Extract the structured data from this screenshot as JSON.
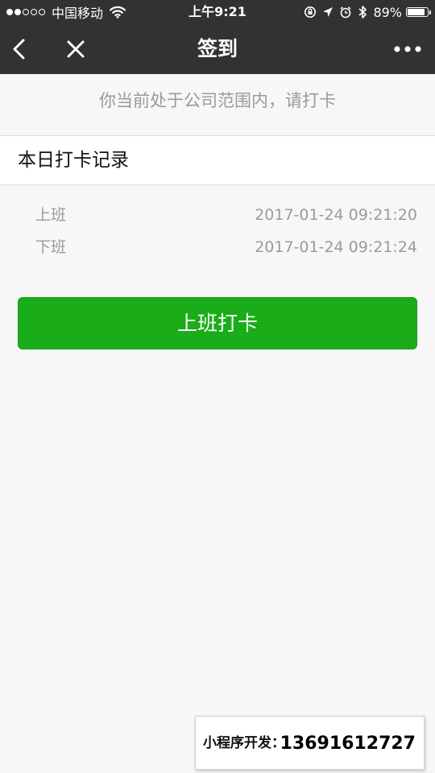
{
  "status_bar": {
    "carrier": "中国移动",
    "time": "上午9:21",
    "battery_percent": "89%",
    "battery_level": 0.89,
    "signal_filled": 2,
    "signal_total": 5
  },
  "nav": {
    "title": "签到",
    "back_icon": "chevron-left-icon",
    "close_icon": "close-icon",
    "more_icon": "more-dots-icon"
  },
  "notice": "你当前处于公司范围内，请打卡",
  "records_section": {
    "title": "本日打卡记录",
    "items": [
      {
        "label": "上班",
        "time": "2017-01-24 09:21:20"
      },
      {
        "label": "下班",
        "time": "2017-01-24 09:21:24"
      }
    ]
  },
  "clock_button": {
    "label": "上班打卡",
    "color": "#1aad19"
  },
  "ad": {
    "label": "小程序开发：",
    "phone": "13691612727"
  }
}
